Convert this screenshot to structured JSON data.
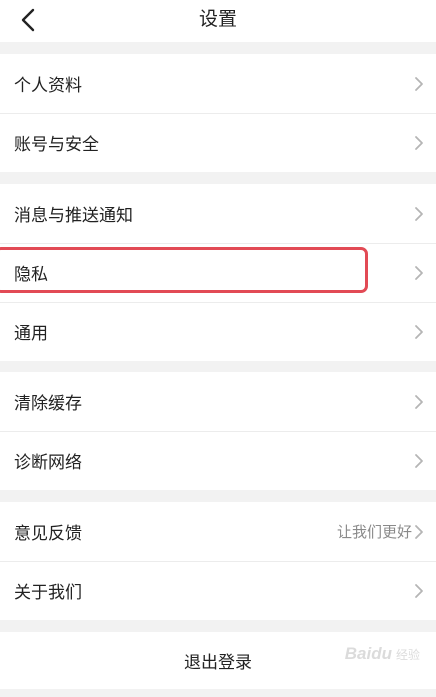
{
  "header": {
    "title": "设置",
    "back_icon": "chevron-left-icon"
  },
  "groups": [
    {
      "items": [
        {
          "label": "个人资料"
        },
        {
          "label": "账号与安全"
        }
      ]
    },
    {
      "items": [
        {
          "label": "消息与推送通知"
        },
        {
          "label": "隐私"
        },
        {
          "label": "通用"
        }
      ]
    },
    {
      "items": [
        {
          "label": "清除缓存"
        },
        {
          "label": "诊断网络"
        }
      ]
    },
    {
      "items": [
        {
          "label": "意见反馈",
          "hint": "让我们更好"
        },
        {
          "label": "关于我们"
        }
      ]
    }
  ],
  "logout": {
    "label": "退出登录"
  },
  "watermark": {
    "brand": "Baidu",
    "sub": "经验"
  },
  "colors": {
    "background": "#f2f2f2",
    "highlight": "#e24a55",
    "chevron": "#b5b5b5",
    "hint": "#8a8a8a"
  }
}
